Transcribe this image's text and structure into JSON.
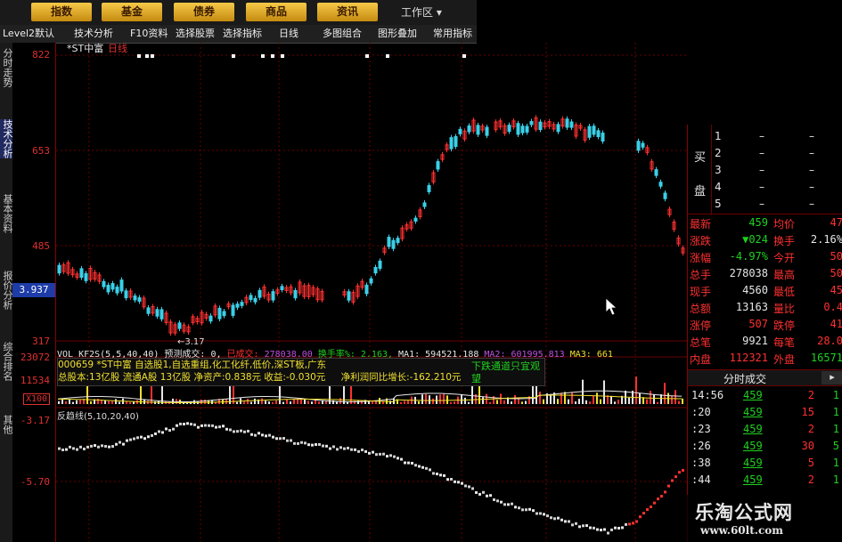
{
  "topbar": {
    "tabs": [
      "指数",
      "基金",
      "债券",
      "商品",
      "资讯"
    ],
    "workarea": "工作区"
  },
  "menubar": {
    "items": [
      "Level2默认",
      "技术分析",
      "F10资料",
      "选择股票",
      "选择指标",
      "日线",
      "多图组合",
      "图形叠加",
      "常用指标"
    ]
  },
  "left_tabs": [
    "分时走势",
    "技术分析",
    "基本资料",
    "报价分析",
    "综合排名",
    "其他"
  ],
  "axis": {
    "main": [
      "822",
      "653",
      "485",
      "317"
    ],
    "current": "3.937",
    "vol": [
      "23072",
      "11534"
    ],
    "vol_unit": "X100",
    "ind": [
      "-3.17",
      "-5.70"
    ]
  },
  "main_chart": {
    "stock_name": "*ST中富",
    "period": "日线",
    "low_label": "3.17"
  },
  "volume_bar": {
    "vol_label": "VOL KF2S(5,5,40,40)",
    "forecast_label": "预测成交: 0,",
    "deal_label": "已成交:",
    "deal_value": "278038.00",
    "turnover_label": "换手率%: 2.163,",
    "ma1": "MA1: 594521.188",
    "ma2": "MA2: 601995.813",
    "ma3": "MA3: 661"
  },
  "info_box": {
    "line1": "000659 *ST中富  自选股1,自选重组,化工化纤,低价,深ST板,广东",
    "line2": "总股本:13亿股  流通A股 13亿股   净资产:0.838元   收益:-0.030元",
    "growth": "净利润同比增长:-162.210元",
    "tip": "下跌通道只宜观望"
  },
  "indicator": {
    "label": "反趋线(5,10,20,40)"
  },
  "orderbook": {
    "side_buy": "买",
    "side_sell": "盘",
    "rows": [
      {
        "n": "1",
        "p": "–",
        "v": "–"
      },
      {
        "n": "2",
        "p": "–",
        "v": "–"
      },
      {
        "n": "3",
        "p": "–",
        "v": "–"
      },
      {
        "n": "4",
        "p": "–",
        "v": "–"
      },
      {
        "n": "5",
        "p": "–",
        "v": "–"
      }
    ]
  },
  "quote": [
    {
      "l1": "最新",
      "v1": "459",
      "l2": "均价",
      "v2": "47"
    },
    {
      "l1": "涨跌",
      "v1": "▼024",
      "l2": "换手",
      "v2": "2.16%"
    },
    {
      "l1": "涨幅",
      "v1": "-4.97%",
      "l2": "今开",
      "v2": "50"
    },
    {
      "l1": "总手",
      "v1": "278038",
      "l2": "最高",
      "v2": "50"
    },
    {
      "l1": "现手",
      "v1": "4560",
      "l2": "最低",
      "v2": "45"
    },
    {
      "l1": "总额",
      "v1": "13163",
      "l2": "量比",
      "v2": "0.4"
    },
    {
      "l1": "涨停",
      "v1": "507",
      "l2": "跌停",
      "v2": "41"
    },
    {
      "l1": "总笔",
      "v1": "9921",
      "l2": "每笔",
      "v2": "28.0"
    },
    {
      "l1": "内盘",
      "v1": "112321",
      "l2": "外盘",
      "v2": "16571"
    }
  ],
  "ticks": {
    "header": "分时成交",
    "rows": [
      {
        "t": "14:56",
        "p": "459",
        "v": "2",
        "f": "1"
      },
      {
        "t": ":20",
        "p": "459",
        "v": "15",
        "f": "1"
      },
      {
        "t": ":23",
        "p": "459",
        "v": "2",
        "f": "1"
      },
      {
        "t": ":26",
        "p": "459",
        "v": "30",
        "f": "5"
      },
      {
        "t": ":38",
        "p": "459",
        "v": "5",
        "f": "1"
      },
      {
        "t": ":44",
        "p": "459",
        "v": "2",
        "f": "1"
      }
    ]
  },
  "watermark": {
    "line1": "乐淘公式网",
    "line2": "www.60lt.com"
  },
  "colors": {
    "up": "#ff3030",
    "down": "#3ad0e8",
    "grid": "#6a0000",
    "accent": "#f7c948"
  }
}
